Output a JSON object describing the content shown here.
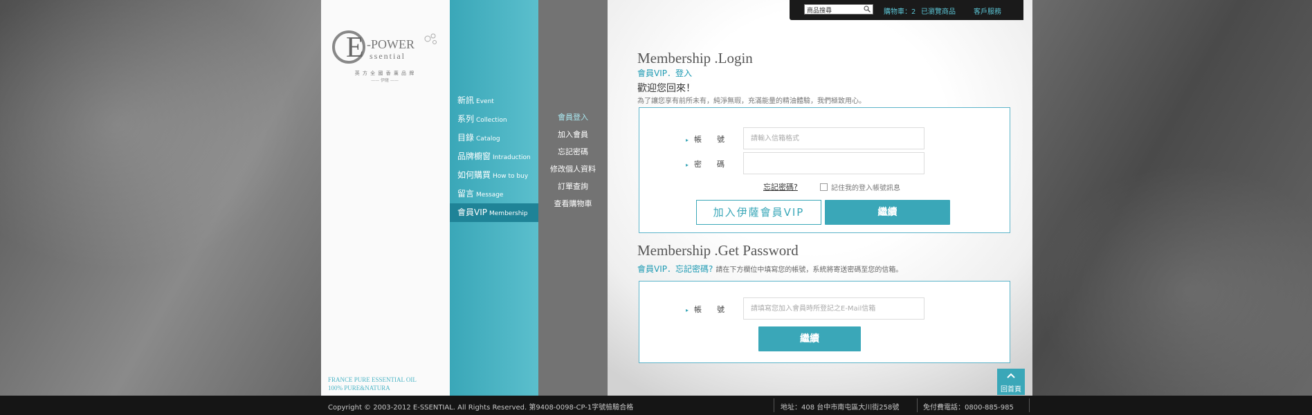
{
  "colors": {
    "accent": "#3aa7b8",
    "accent_dark": "#1f8397",
    "link": "#5cc4d4",
    "footer_bg": "#151515"
  },
  "brand": {
    "logo_big_letter": "E",
    "logo_top": "-POWER",
    "logo_bottom": "ssential",
    "slogan": "英 方 全 國 香 薰 品 牌",
    "slogan_sub": "—— 伊薩 ——",
    "tagline_1": "FRANCE PURE ESSENTIAL OIL",
    "tagline_2": "100% PURE&NATURA"
  },
  "nav": {
    "items": [
      {
        "zh": "新訊",
        "en": "Event"
      },
      {
        "zh": "系列",
        "en": "Collection"
      },
      {
        "zh": "目錄",
        "en": "Catalog"
      },
      {
        "zh": "品牌櫥窗",
        "en": "Intraduction"
      },
      {
        "zh": "如何購買",
        "en": "How to buy"
      },
      {
        "zh": "留言",
        "en": "Message"
      },
      {
        "zh": "會員VIP",
        "en": "Membership"
      }
    ]
  },
  "subnav": {
    "items": [
      {
        "label": "會員登入"
      },
      {
        "label": "加入會員"
      },
      {
        "label": "忘記密碼"
      },
      {
        "label": "修改個人資料"
      },
      {
        "label": "訂單查詢"
      },
      {
        "label": "查看購物車"
      }
    ]
  },
  "topbar": {
    "search_placeholder": "商品搜尋",
    "cart": "購物車：2",
    "viewed": "已瀏覽商品",
    "service": "客戶服務"
  },
  "login": {
    "title": "Membership .Login",
    "subtitle": "會員VIP．登入",
    "welcome": "歡迎您回來！",
    "welcome_desc": "為了讓您享有前所未有，純淨無瑕，充滿能量的精油體驗，我們極致用心。",
    "account_label": "帳　　號",
    "account_placeholder": "請輸入信箱格式",
    "password_label": "密　　碼",
    "forgot": "忘記密碼?",
    "remember": "記住我的登入帳號訊息",
    "join_button": "加入伊薩會員VIP",
    "continue_button": "繼續"
  },
  "getpass": {
    "title": "Membership .Get Password",
    "subtitle": "會員VIP．忘記密碼?",
    "desc": "請在下方欄位中填寫您的帳號，系統將寄送密碼至您的信箱。",
    "account_label": "帳　　號",
    "account_placeholder": "請填寫您加入會員時所登記之E-Mail信箱",
    "continue_button": "繼續"
  },
  "back_top": "回首頁",
  "footer": {
    "copyright": "Copyright © 2003-2012 E-SSENTIAL. All Rights Reserved.  第9408-0098-CP-1字號檢驗合格",
    "address": "地址：408 台中市南屯區大川街258號",
    "phone": "免付費電話：0800-885-985"
  }
}
